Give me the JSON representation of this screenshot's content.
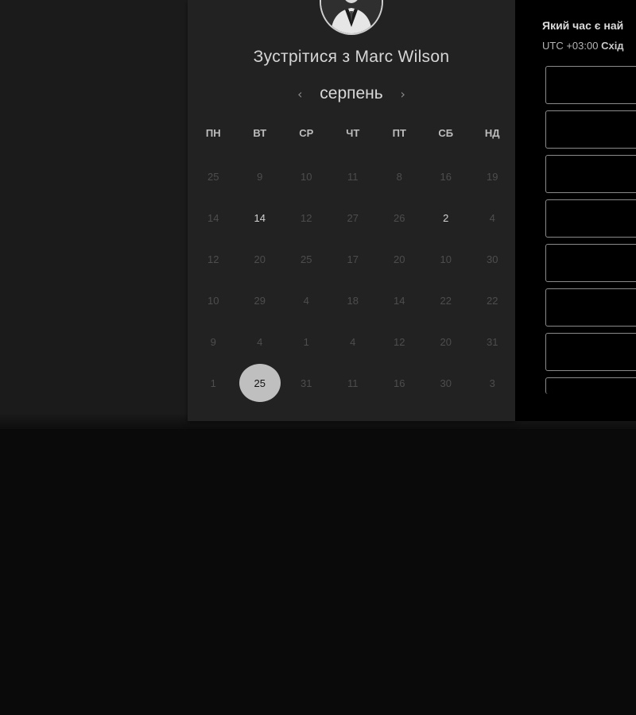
{
  "booking": {
    "host_name": "Marc Wilson",
    "heading": "Зустрітися з Marc Wilson",
    "month": "серпень",
    "prev_icon": "chevron-left-icon",
    "next_icon": "chevron-right-icon",
    "weekdays": [
      "ПН",
      "ВТ",
      "СР",
      "ЧТ",
      "ПТ",
      "СБ",
      "НД"
    ],
    "weeks": [
      [
        "25",
        "9",
        "10",
        "11",
        "8",
        "16",
        "19"
      ],
      [
        "14",
        "14",
        "12",
        "27",
        "26",
        "2",
        "4"
      ],
      [
        "12",
        "20",
        "25",
        "17",
        "20",
        "10",
        "30"
      ],
      [
        "10",
        "29",
        "4",
        "18",
        "14",
        "22",
        "22"
      ],
      [
        "9",
        "4",
        "1",
        "4",
        "12",
        "20",
        "31"
      ],
      [
        "1",
        "25",
        "31",
        "11",
        "16",
        "30",
        "3"
      ]
    ],
    "available_days": [
      [
        1,
        1
      ],
      [
        1,
        5
      ]
    ],
    "selected_day": [
      5,
      1
    ]
  },
  "time_panel": {
    "question": "Який час є най",
    "timezone_offset": "UTC +03:00",
    "timezone_name": "Схід",
    "slot_count": 8
  },
  "colors": {
    "page_bg": "#0a0a0a",
    "card_bg": "#222222",
    "selected_bg": "#bfbfbf",
    "slot_border": "#8a8a8a"
  }
}
